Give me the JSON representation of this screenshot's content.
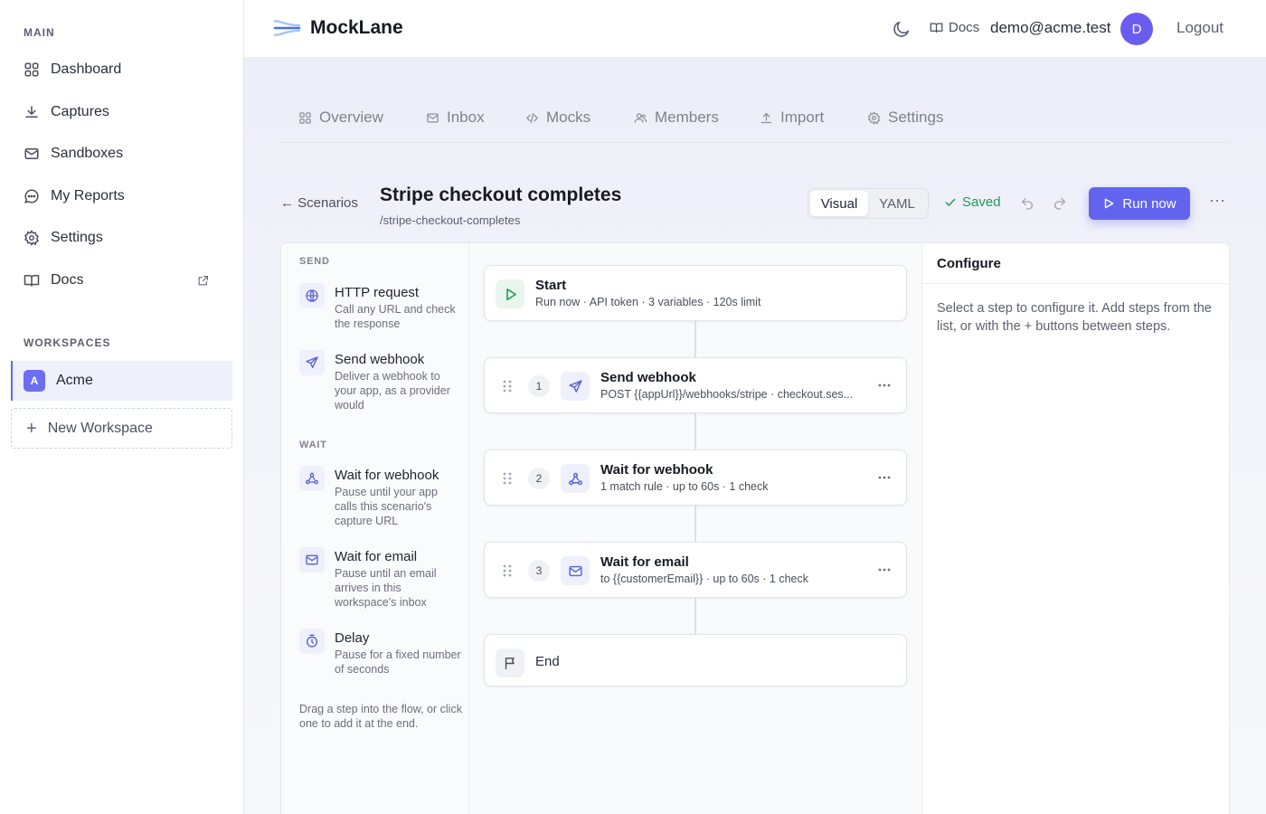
{
  "sidebar": {
    "main_heading": "MAIN",
    "items": [
      {
        "label": "Dashboard",
        "icon": "grid-icon"
      },
      {
        "label": "Captures",
        "icon": "download-icon"
      },
      {
        "label": "Sandboxes",
        "icon": "mail-icon"
      },
      {
        "label": "My Reports",
        "icon": "chat-icon"
      },
      {
        "label": "Settings",
        "icon": "gear-icon"
      },
      {
        "label": "Docs",
        "icon": "book-icon",
        "external": true
      }
    ],
    "workspaces_heading": "WORKSPACES",
    "workspace": {
      "initial": "A",
      "name": "Acme"
    },
    "new_workspace": "New Workspace"
  },
  "topbar": {
    "brand": "MockLane",
    "docs": "Docs",
    "email": "demo@acme.test",
    "avatar_initial": "D",
    "logout": "Logout"
  },
  "tabs": [
    {
      "label": "Overview",
      "icon": "grid-icon"
    },
    {
      "label": "Inbox",
      "icon": "mail-icon"
    },
    {
      "label": "Mocks",
      "icon": "code-icon"
    },
    {
      "label": "Members",
      "icon": "users-icon"
    },
    {
      "label": "Import",
      "icon": "upload-icon"
    },
    {
      "label": "Settings",
      "icon": "gear-icon"
    }
  ],
  "header": {
    "back": "← Scenarios",
    "title": "Stripe checkout completes",
    "slug": "/stripe-checkout-completes",
    "view_visual": "Visual",
    "view_yaml": "YAML",
    "active_view": "Visual",
    "saved": "Saved",
    "run": "Run now",
    "more": "···"
  },
  "palette": {
    "send_heading": "SEND",
    "wait_heading": "WAIT",
    "items": [
      {
        "title": "HTTP request",
        "desc": "Call any URL and check the response",
        "icon": "globe-icon"
      },
      {
        "title": "Send webhook",
        "desc": "Deliver a webhook to your app, as a provider would",
        "icon": "send-icon"
      },
      {
        "title": "Wait for webhook",
        "desc": "Pause until your app calls this scenario's capture URL",
        "icon": "webhook-icon"
      },
      {
        "title": "Wait for email",
        "desc": "Pause until an email arrives in this workspace's inbox",
        "icon": "mail-icon"
      },
      {
        "title": "Delay",
        "desc": "Pause for a fixed number of seconds",
        "icon": "timer-icon"
      }
    ],
    "hint": "Drag a step into the flow, or click one to add it at the end."
  },
  "flow": {
    "start": {
      "title": "Start",
      "sub": "Run now · API token · 3 variables · 120s limit"
    },
    "steps": [
      {
        "num": "1",
        "title": "Send webhook",
        "sub": "POST {{appUrl}}/webhooks/stripe · checkout.ses...",
        "icon": "send-icon"
      },
      {
        "num": "2",
        "title": "Wait for webhook",
        "sub": "1 match rule · up to 60s · 1 check",
        "icon": "webhook-icon"
      },
      {
        "num": "3",
        "title": "Wait for email",
        "sub": "to {{customerEmail}} · up to 60s · 1 check",
        "icon": "mail-icon"
      }
    ],
    "end": {
      "title": "End"
    }
  },
  "configure": {
    "title": "Configure",
    "body": "Select a step to configure it. Add steps from the list, or with the + buttons between steps."
  },
  "colors": {
    "accent": "#6264f0",
    "saved": "#1d9a55"
  }
}
